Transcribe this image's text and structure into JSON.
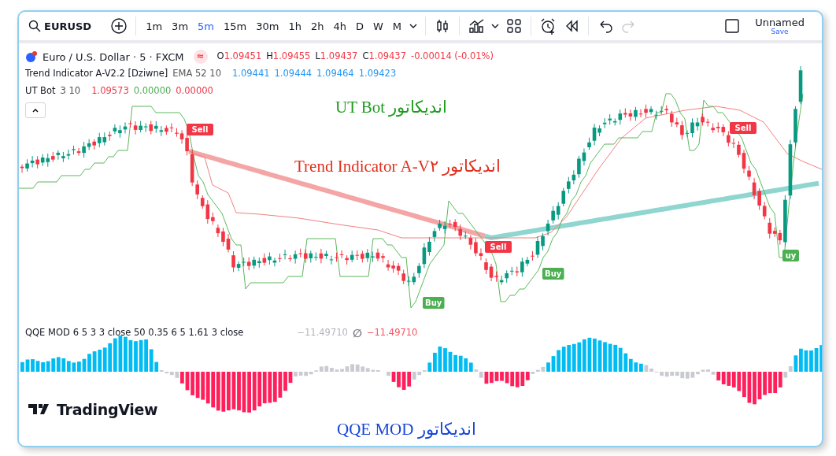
{
  "toolbar": {
    "symbol": "EURUSD",
    "intervals": [
      {
        "label": "1m",
        "selected": false
      },
      {
        "label": "3m",
        "selected": false
      },
      {
        "label": "5m",
        "selected": true
      },
      {
        "label": "15m",
        "selected": false
      },
      {
        "label": "30m",
        "selected": false
      },
      {
        "label": "1h",
        "selected": false
      },
      {
        "label": "2h",
        "selected": false
      },
      {
        "label": "4h",
        "selected": false
      },
      {
        "label": "D",
        "selected": false
      },
      {
        "label": "W",
        "selected": false
      },
      {
        "label": "M",
        "selected": false
      }
    ],
    "redo_disabled": true,
    "layout_name": "Unnamed",
    "save_label": "Save"
  },
  "legend": {
    "title": "Euro / U.S. Dollar · 5 · FXCM",
    "status_icon": "≈",
    "ohlc": [
      {
        "label": "O",
        "value": "1.09451"
      },
      {
        "label": "H",
        "value": "1.09455"
      },
      {
        "label": "L",
        "value": "1.09437"
      },
      {
        "label": "C",
        "value": "1.09437"
      }
    ],
    "change": "-0.00014 (-0.01%)",
    "indicators": [
      {
        "name": "Trend Indicator A-V2.2 [Dziwne]",
        "params": "EMA 52 10",
        "values": [
          {
            "text": "1.09441",
            "color": "#2196f3"
          },
          {
            "text": "1.09444",
            "color": "#2196f3"
          },
          {
            "text": "1.09464",
            "color": "#2196f3"
          },
          {
            "text": "1.09423",
            "color": "#2196f3"
          }
        ]
      },
      {
        "name": "UT Bot",
        "params": "3 10",
        "values": [
          {
            "text": "1.09573",
            "color": "#f23645"
          },
          {
            "text": "0.00000",
            "color": "#4caf50"
          },
          {
            "text": "0.00000",
            "color": "#f23645"
          }
        ]
      }
    ]
  },
  "signals": [
    {
      "kind": "sell",
      "text": "Sell"
    },
    {
      "kind": "buy",
      "text": "Buy"
    },
    {
      "kind": "sell",
      "text": "Sell"
    },
    {
      "kind": "buy",
      "text": "Buy"
    },
    {
      "kind": "sell",
      "text": "Sell"
    },
    {
      "kind": "buy",
      "text": "uy"
    }
  ],
  "annotations": [
    {
      "text": "اندیکاتور UT Bot",
      "color": "#1e9b1e"
    },
    {
      "text": "اندیکاتور Trend Indicator A-V۲",
      "color": "#e0301e"
    },
    {
      "text": "اندیکاتور QQE MOD",
      "color": "#1546d8"
    }
  ],
  "qqe": {
    "name": "QQE MOD",
    "params": "6 5 3 3 close 50 0.35 6 5 1.61 3 close",
    "values": [
      {
        "text": "−11.49710",
        "color": "#b2b5be"
      },
      {
        "text": "∅",
        "color": "#787b86"
      },
      {
        "text": "−11.49710",
        "color": "#f7525f"
      }
    ]
  },
  "branding": "TradingView"
}
